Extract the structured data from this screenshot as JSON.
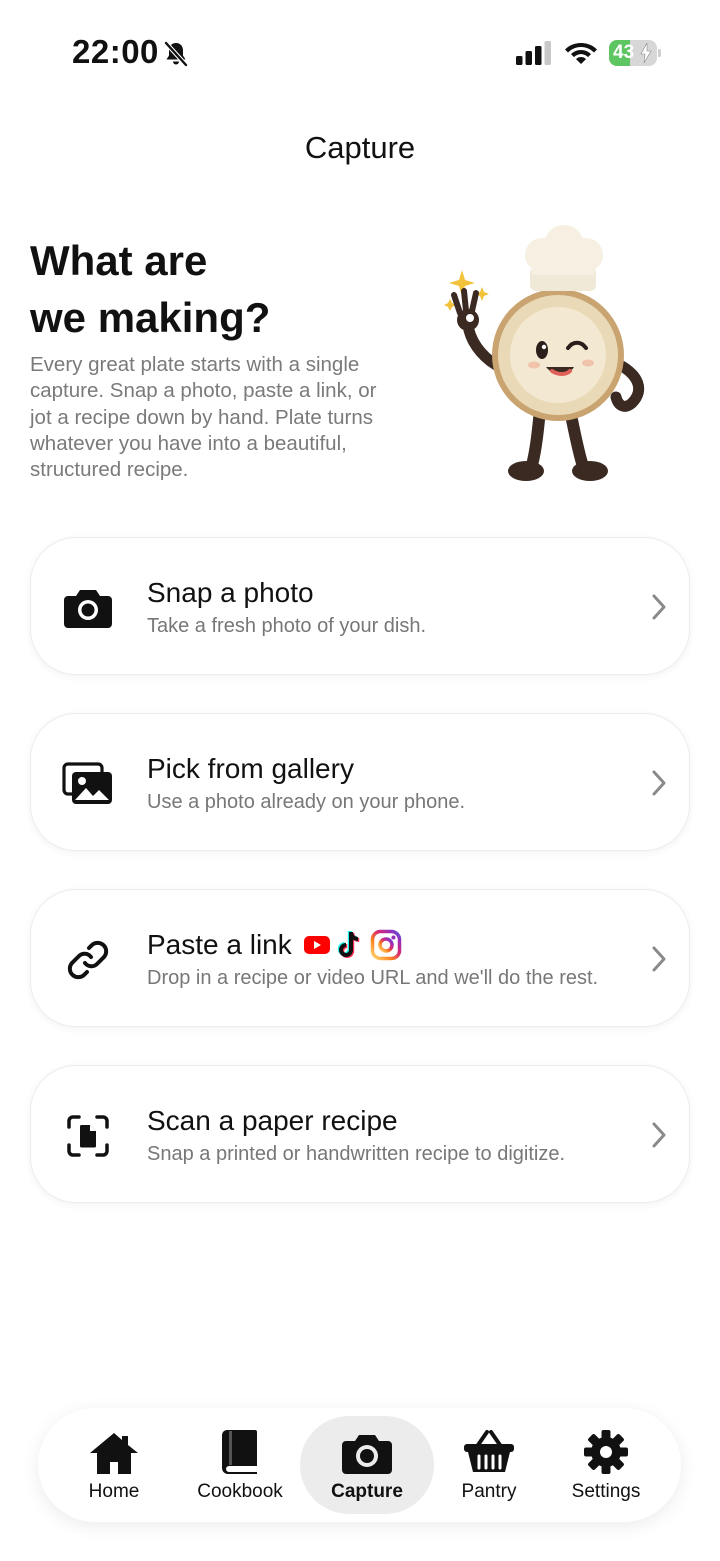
{
  "status_bar": {
    "time": "22:00",
    "battery_percent": 43,
    "battery_label": "43",
    "icons": [
      "bell-slash-icon",
      "cellular-signal-icon",
      "wifi-icon",
      "battery-charging-icon"
    ]
  },
  "header": {
    "title": "Capture"
  },
  "hero": {
    "title_line1": "What are",
    "title_line2": "we making?",
    "body": "Every great plate starts with a single capture. Snap a photo, paste a link, or jot a recipe down by hand. Plate turns whatever you have into a beautiful, structured recipe.",
    "illustration": "chef-plate-mascot"
  },
  "options": [
    {
      "title": "Snap a photo",
      "subtitle": "Take a fresh photo of your dish.",
      "icon": "camera-icon"
    },
    {
      "title": "Pick from gallery",
      "subtitle": "Use a photo already on your phone.",
      "icon": "gallery-icon"
    },
    {
      "title": "Paste a link",
      "subtitle": "Drop in a recipe or video URL and we'll do the rest.",
      "icon": "link-icon",
      "brand_icons": [
        "youtube-icon",
        "tiktok-icon",
        "instagram-icon"
      ]
    },
    {
      "title": "Scan a paper recipe",
      "subtitle": "Snap a printed or handwritten recipe to digitize.",
      "icon": "scan-document-icon"
    }
  ],
  "nav": {
    "items": [
      {
        "label": "Home",
        "icon": "home-icon"
      },
      {
        "label": "Cookbook",
        "icon": "book-icon"
      },
      {
        "label": "Capture",
        "icon": "camera-icon",
        "active": true
      },
      {
        "label": "Pantry",
        "icon": "basket-icon"
      },
      {
        "label": "Settings",
        "icon": "gear-icon"
      }
    ]
  },
  "colors": {
    "battery_green": "#5dc562",
    "body_gray": "#7a7a7a",
    "active_tab_bg": "#ececec",
    "youtube_red": "#ff0000"
  }
}
